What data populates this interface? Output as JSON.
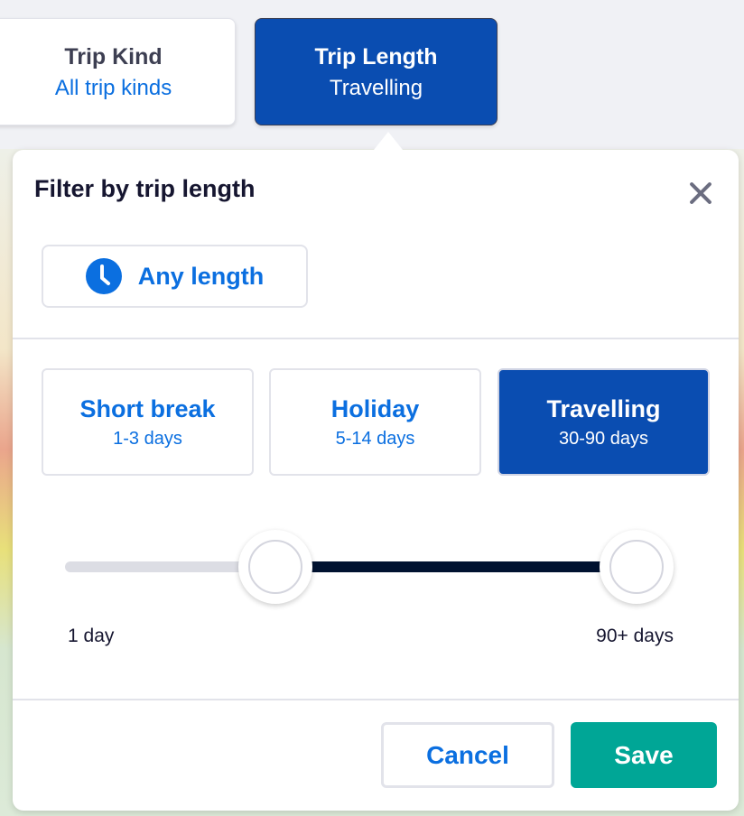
{
  "filters": [
    {
      "label": "Trip Kind",
      "value": "All trip kinds",
      "active": false
    },
    {
      "label": "Trip Length",
      "value": "Travelling",
      "active": true
    }
  ],
  "popover": {
    "title": "Filter by trip length",
    "close_icon": "close-icon",
    "any_length": {
      "label": "Any length",
      "icon": "clock-icon"
    },
    "options": [
      {
        "label": "Short break",
        "sub": "1-3 days",
        "selected": false
      },
      {
        "label": "Holiday",
        "sub": "5-14 days",
        "selected": false
      },
      {
        "label": "Travelling",
        "sub": "30-90 days",
        "selected": true
      }
    ],
    "slider": {
      "min_label": "1 day",
      "max_label": "90+ days",
      "range_days": [
        30,
        90
      ]
    },
    "cancel": "Cancel",
    "save": "Save"
  },
  "colors": {
    "primary": "#0a4db1",
    "link": "#0b6fe0",
    "save": "#00a696"
  }
}
